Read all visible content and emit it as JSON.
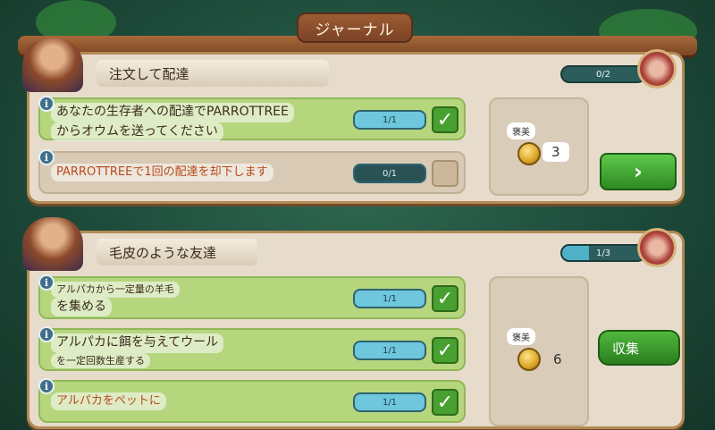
{
  "journal_title": "ジャーナル",
  "quests": [
    {
      "title": "注文して配達",
      "progress_label": "0/2",
      "progress_fraction": 0,
      "tasks": [
        {
          "lines": [
            "あなたの生存者への配達でPARROTTREE",
            "からオウムを送ってください"
          ],
          "progress": "1/1",
          "done": true
        },
        {
          "lines": [
            "PARROTTREEで1回の配達を却下します"
          ],
          "progress": "0/1",
          "done": false
        }
      ],
      "reward_label": "褒美",
      "reward_amount": "3",
      "action_icon": "chevron-right-icon",
      "action_label": "›"
    },
    {
      "title": "毛皮のような友達",
      "progress_label": "1/3",
      "progress_fraction": 0.33,
      "tasks": [
        {
          "lines": [
            "アルパカから一定量の羊毛",
            "を集める"
          ],
          "progress": "1/1",
          "done": true
        },
        {
          "lines": [
            "アルパカに餌を与えてウール",
            "を一定回数生産する"
          ],
          "progress": "1/1",
          "done": true
        },
        {
          "lines": [
            "アルパカをペットに"
          ],
          "progress": "1/1",
          "done": true
        }
      ],
      "reward_label": "褒美",
      "reward_amount": "6",
      "action_label": "収集"
    }
  ],
  "icons": {
    "info": "i",
    "check": "✓"
  },
  "colors": {
    "done_task_bg": "#b6d67e",
    "pending_task_bg": "#d8cab4",
    "button_green": "#3fa630",
    "progress_cyan": "#6ec7dd"
  }
}
